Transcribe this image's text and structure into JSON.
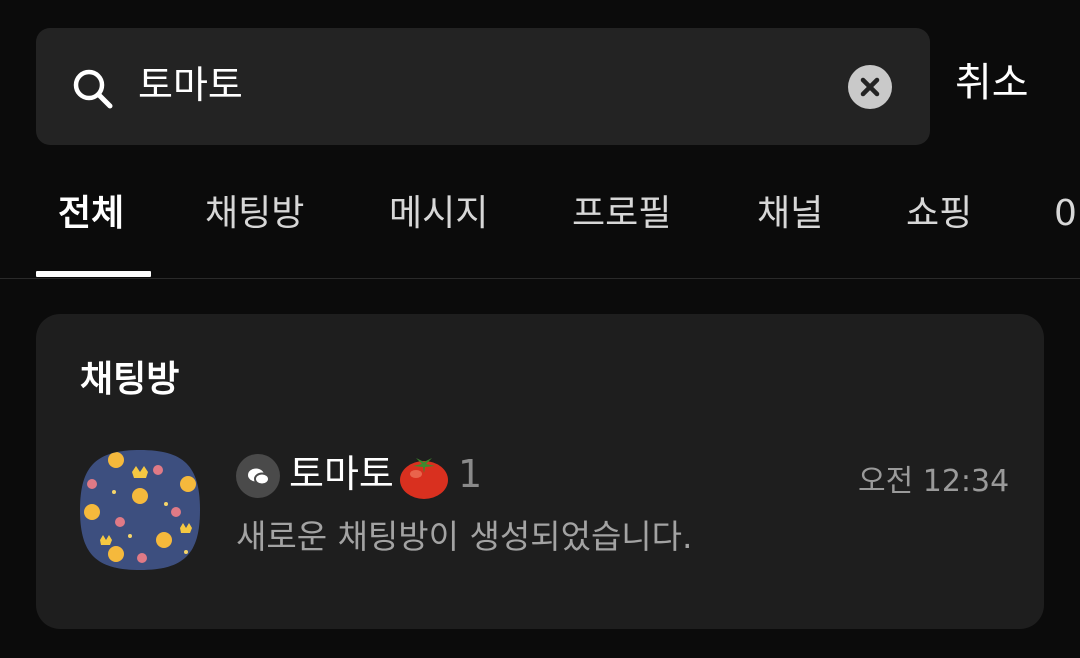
{
  "search": {
    "query": "토마토",
    "icon": "search-icon",
    "clear_icon": "clear-icon",
    "cancel_label": "취소"
  },
  "tabs": [
    {
      "label": "전체",
      "active": true
    },
    {
      "label": "채팅방",
      "active": false
    },
    {
      "label": "메시지",
      "active": false
    },
    {
      "label": "프로필",
      "active": false
    },
    {
      "label": "채널",
      "active": false
    },
    {
      "label": "쇼핑",
      "active": false
    },
    {
      "label": "0",
      "active": false
    }
  ],
  "results": {
    "section_title": "채팅방",
    "rooms": [
      {
        "type_icon": "open-chat-icon",
        "name": "토마토",
        "emoji_icon": "tomato-icon",
        "member_count": "1",
        "time": "오전 12:34",
        "preview": "새로운 채팅방이 생성되었습니다."
      }
    ]
  },
  "colors": {
    "background": "#0b0b0b",
    "search_bg": "#232323",
    "card_bg": "#1e1e1e",
    "secondary_text": "#a3a3a3",
    "avatar_bg": "#3d4f7f"
  }
}
